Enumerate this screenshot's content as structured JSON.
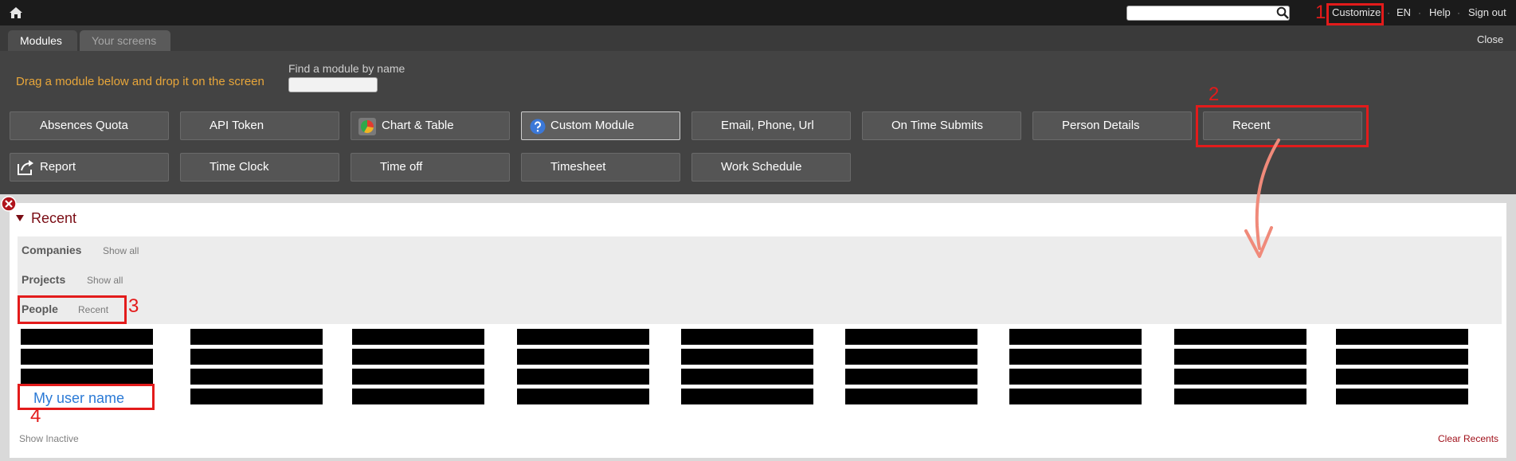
{
  "topbar": {
    "search_value": "",
    "links": [
      "Customize",
      "EN",
      "Help",
      "Sign out"
    ],
    "separator": "·"
  },
  "tabs": [
    {
      "label": "Modules",
      "active": true
    },
    {
      "label": "Your screens",
      "active": false
    }
  ],
  "close_label": "Close",
  "modules_panel": {
    "drag_hint": "Drag a module below and drop it on the screen",
    "find_label": "Find a module by name",
    "find_value": "",
    "row1": [
      "Absences Quota",
      "API Token",
      "Chart & Table",
      "Custom Module",
      "Email, Phone, Url",
      "On Time Submits",
      "Person Details",
      "Recent"
    ],
    "row2": [
      "Report",
      "Time Clock",
      "Time off",
      "Timesheet",
      "Work Schedule"
    ],
    "icons": {
      "chart_table": "chart-table-icon",
      "custom_module": "question-icon",
      "report": "report-export-icon"
    }
  },
  "recent": {
    "title": "Recent",
    "categories": [
      {
        "label": "Companies",
        "action": "Show all"
      },
      {
        "label": "Projects",
        "action": "Show all"
      },
      {
        "label": "People",
        "action": "Recent"
      }
    ],
    "user_name": "My user name",
    "show_inactive": "Show Inactive",
    "clear_recents": "Clear Recents"
  },
  "annotations": {
    "numbers": [
      "1",
      "2",
      "3",
      "4"
    ],
    "color": "#e31b1b",
    "arrow_color": "#f08a7a"
  },
  "colors": {
    "accent_orange": "#e8a63a",
    "title_red": "#7a0c14",
    "link_blue": "#2b7ad6"
  }
}
